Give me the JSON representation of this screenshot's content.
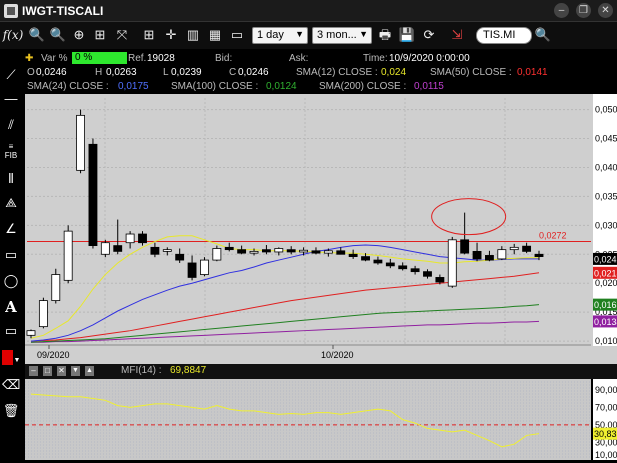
{
  "window": {
    "title": "IWGT-TISCALI"
  },
  "toolbar": {
    "fx_label": "f(x)",
    "period": "1 day",
    "range": "3 mon...",
    "symbol": "TIS.MI"
  },
  "info": {
    "var_label": "Var %",
    "var_value": "0 %",
    "ref_label": "Ref.",
    "ref_value": "19028",
    "bid_label": "Bid:",
    "ask_label": "Ask:",
    "time_label": "Time:",
    "time_value": "10/9/2020 0:00:00",
    "o_label": "O",
    "o_value": "0,0246",
    "h_label": "H",
    "h_value": "0,0263",
    "l_label": "L",
    "l_value": "0,0239",
    "c_label": "C",
    "c_value": "0,0246",
    "sma12_label": "SMA(12) CLOSE :",
    "sma12_value": "0,024",
    "sma50_label": "SMA(50) CLOSE :",
    "sma50_value": "0,0141",
    "sma24_label": "SMA(24) CLOSE :",
    "sma24_value": "0,0175",
    "sma100_label": "SMA(100) CLOSE :",
    "sma100_value": "0,0124",
    "sma200_label": "SMA(200) CLOSE :",
    "sma200_value": "0,0115"
  },
  "colors": {
    "sma12": "#e8e82a",
    "sma24": "#3030e0",
    "sma50": "#e02020",
    "sma100": "#208020",
    "sma200": "#9020a0",
    "bull": "#ffffff",
    "bear": "#000000",
    "hline": "#e02020"
  },
  "price_axis": {
    "ticks": [
      "0,0500",
      "0,0450",
      "0,0400",
      "0,0350",
      "0,0300",
      "0,0250",
      "0,0200",
      "0,0150",
      "0,0100"
    ],
    "hline_label": "0,0272",
    "last_label": "0,0242",
    "sma50_label": "0,0218",
    "sma100_label": "0,0163",
    "sma200_label": "0,0134"
  },
  "time_axis": {
    "labels": [
      "09/2020",
      "10/2020"
    ]
  },
  "mfi": {
    "label": "MFI(14) :",
    "value": "69,8847",
    "ticks": [
      "90,00",
      "70,00",
      "50,00",
      "30,00",
      "10,00"
    ],
    "last_label": "30,83"
  },
  "chart_data": {
    "type": "candlestick",
    "ylim": [
      0.0095,
      0.052
    ],
    "candles": [
      {
        "o": 0.011,
        "h": 0.012,
        "l": 0.0105,
        "c": 0.0118
      },
      {
        "o": 0.0125,
        "h": 0.0175,
        "l": 0.0122,
        "c": 0.017
      },
      {
        "o": 0.017,
        "h": 0.0225,
        "l": 0.0165,
        "c": 0.0215
      },
      {
        "o": 0.0205,
        "h": 0.03,
        "l": 0.02,
        "c": 0.029
      },
      {
        "o": 0.0395,
        "h": 0.05,
        "l": 0.039,
        "c": 0.049
      },
      {
        "o": 0.044,
        "h": 0.045,
        "l": 0.026,
        "c": 0.0265
      },
      {
        "o": 0.025,
        "h": 0.0275,
        "l": 0.0245,
        "c": 0.027
      },
      {
        "o": 0.0265,
        "h": 0.031,
        "l": 0.025,
        "c": 0.0255
      },
      {
        "o": 0.027,
        "h": 0.029,
        "l": 0.026,
        "c": 0.0285
      },
      {
        "o": 0.0285,
        "h": 0.029,
        "l": 0.0265,
        "c": 0.027
      },
      {
        "o": 0.0262,
        "h": 0.027,
        "l": 0.0245,
        "c": 0.025
      },
      {
        "o": 0.0255,
        "h": 0.0262,
        "l": 0.0248,
        "c": 0.0258
      },
      {
        "o": 0.025,
        "h": 0.026,
        "l": 0.0235,
        "c": 0.024
      },
      {
        "o": 0.0235,
        "h": 0.0248,
        "l": 0.0205,
        "c": 0.021
      },
      {
        "o": 0.0215,
        "h": 0.0245,
        "l": 0.0212,
        "c": 0.024
      },
      {
        "o": 0.024,
        "h": 0.0265,
        "l": 0.0238,
        "c": 0.026
      },
      {
        "o": 0.0262,
        "h": 0.027,
        "l": 0.0255,
        "c": 0.0258
      },
      {
        "o": 0.0258,
        "h": 0.0265,
        "l": 0.025,
        "c": 0.0252
      },
      {
        "o": 0.0252,
        "h": 0.026,
        "l": 0.0248,
        "c": 0.0255
      },
      {
        "o": 0.0258,
        "h": 0.0266,
        "l": 0.025,
        "c": 0.0254
      },
      {
        "o": 0.0254,
        "h": 0.0262,
        "l": 0.0248,
        "c": 0.026
      },
      {
        "o": 0.0258,
        "h": 0.0264,
        "l": 0.025,
        "c": 0.0254
      },
      {
        "o": 0.0254,
        "h": 0.0262,
        "l": 0.0248,
        "c": 0.0257
      },
      {
        "o": 0.0256,
        "h": 0.0262,
        "l": 0.025,
        "c": 0.0252
      },
      {
        "o": 0.0252,
        "h": 0.026,
        "l": 0.0246,
        "c": 0.0256
      },
      {
        "o": 0.0256,
        "h": 0.0262,
        "l": 0.025,
        "c": 0.025
      },
      {
        "o": 0.025,
        "h": 0.0258,
        "l": 0.0242,
        "c": 0.0246
      },
      {
        "o": 0.0246,
        "h": 0.0252,
        "l": 0.0238,
        "c": 0.024
      },
      {
        "o": 0.024,
        "h": 0.0246,
        "l": 0.0232,
        "c": 0.0235
      },
      {
        "o": 0.0235,
        "h": 0.0242,
        "l": 0.0226,
        "c": 0.023
      },
      {
        "o": 0.023,
        "h": 0.0236,
        "l": 0.0222,
        "c": 0.0225
      },
      {
        "o": 0.0225,
        "h": 0.023,
        "l": 0.0215,
        "c": 0.022
      },
      {
        "o": 0.022,
        "h": 0.0224,
        "l": 0.0208,
        "c": 0.0212
      },
      {
        "o": 0.021,
        "h": 0.0215,
        "l": 0.0198,
        "c": 0.0202
      },
      {
        "o": 0.0195,
        "h": 0.028,
        "l": 0.0192,
        "c": 0.0275
      },
      {
        "o": 0.0275,
        "h": 0.0322,
        "l": 0.025,
        "c": 0.0252
      },
      {
        "o": 0.0255,
        "h": 0.027,
        "l": 0.0238,
        "c": 0.0242
      },
      {
        "o": 0.0248,
        "h": 0.0256,
        "l": 0.0238,
        "c": 0.024
      },
      {
        "o": 0.0242,
        "h": 0.0264,
        "l": 0.024,
        "c": 0.0258
      },
      {
        "o": 0.0258,
        "h": 0.0268,
        "l": 0.025,
        "c": 0.0262
      },
      {
        "o": 0.0264,
        "h": 0.027,
        "l": 0.0252,
        "c": 0.0255
      },
      {
        "o": 0.025,
        "h": 0.0256,
        "l": 0.024,
        "c": 0.0246
      }
    ],
    "sma12": [
      0.0105,
      0.011,
      0.0122,
      0.0135,
      0.016,
      0.019,
      0.0215,
      0.0235,
      0.025,
      0.0262,
      0.0272,
      0.028,
      0.0282,
      0.0282,
      0.0275,
      0.0268,
      0.026,
      0.0258,
      0.0258,
      0.0256,
      0.0256,
      0.0256,
      0.0255,
      0.0254,
      0.0253,
      0.0252,
      0.0252,
      0.025,
      0.0248,
      0.0245,
      0.0242,
      0.024,
      0.0238,
      0.0235,
      0.0235,
      0.0237,
      0.0238,
      0.024,
      0.0242,
      0.0243,
      0.0244,
      0.0244
    ],
    "sma24": [
      0.01,
      0.0102,
      0.0105,
      0.011,
      0.0118,
      0.0128,
      0.014,
      0.0152,
      0.0162,
      0.0172,
      0.018,
      0.0188,
      0.0195,
      0.02,
      0.0206,
      0.0212,
      0.0218,
      0.0222,
      0.0228,
      0.0235,
      0.024,
      0.0245,
      0.025,
      0.0255,
      0.0258,
      0.0262,
      0.0265,
      0.0266,
      0.0265,
      0.0262,
      0.0258,
      0.0254,
      0.025,
      0.0246,
      0.0244,
      0.0242,
      0.024,
      0.024,
      0.0241,
      0.0242,
      0.0242,
      0.0242
    ],
    "sma50": [
      0.01,
      0.0101,
      0.0102,
      0.0104,
      0.0106,
      0.0109,
      0.0112,
      0.0115,
      0.0118,
      0.0122,
      0.0126,
      0.013,
      0.0134,
      0.0138,
      0.0142,
      0.0146,
      0.015,
      0.0154,
      0.0158,
      0.0162,
      0.0166,
      0.017,
      0.0173,
      0.0176,
      0.0179,
      0.0182,
      0.0185,
      0.0188,
      0.019,
      0.0192,
      0.0194,
      0.0196,
      0.0198,
      0.02,
      0.0202,
      0.0204,
      0.0206,
      0.0208,
      0.021,
      0.0212,
      0.0215,
      0.0218
    ],
    "sma100": [
      0.0098,
      0.0099,
      0.01,
      0.0101,
      0.0102,
      0.0103,
      0.0104,
      0.0106,
      0.0108,
      0.011,
      0.0112,
      0.0114,
      0.0116,
      0.0118,
      0.012,
      0.0122,
      0.0124,
      0.0126,
      0.0128,
      0.013,
      0.0132,
      0.0134,
      0.0136,
      0.0138,
      0.014,
      0.0142,
      0.0144,
      0.0146,
      0.0148,
      0.0149,
      0.015,
      0.0151,
      0.0152,
      0.0153,
      0.0154,
      0.0155,
      0.0156,
      0.0157,
      0.0158,
      0.016,
      0.0161,
      0.0163
    ],
    "sma200": [
      0.0098,
      0.0098,
      0.0099,
      0.0099,
      0.01,
      0.0101,
      0.0102,
      0.0103,
      0.0104,
      0.0105,
      0.0106,
      0.0107,
      0.0108,
      0.0109,
      0.011,
      0.0111,
      0.0112,
      0.0113,
      0.0114,
      0.0115,
      0.0116,
      0.0117,
      0.0118,
      0.0119,
      0.012,
      0.0121,
      0.0122,
      0.0123,
      0.0124,
      0.0125,
      0.0126,
      0.0127,
      0.0128,
      0.0128,
      0.0129,
      0.013,
      0.0131,
      0.0131,
      0.0132,
      0.0133,
      0.0133,
      0.0134
    ],
    "hline": 0.0272,
    "mfi": {
      "ylim": [
        10,
        100
      ],
      "values": [
        85,
        84,
        83,
        82,
        82,
        80,
        78,
        72,
        70,
        72,
        74,
        74,
        72,
        70,
        68,
        72,
        68,
        66,
        66,
        64,
        62,
        63,
        62,
        64,
        64,
        62,
        64,
        66,
        68,
        66,
        56,
        52,
        46,
        44,
        42,
        44,
        38,
        32,
        25,
        28,
        38,
        40
      ],
      "ref_level": 50
    }
  }
}
